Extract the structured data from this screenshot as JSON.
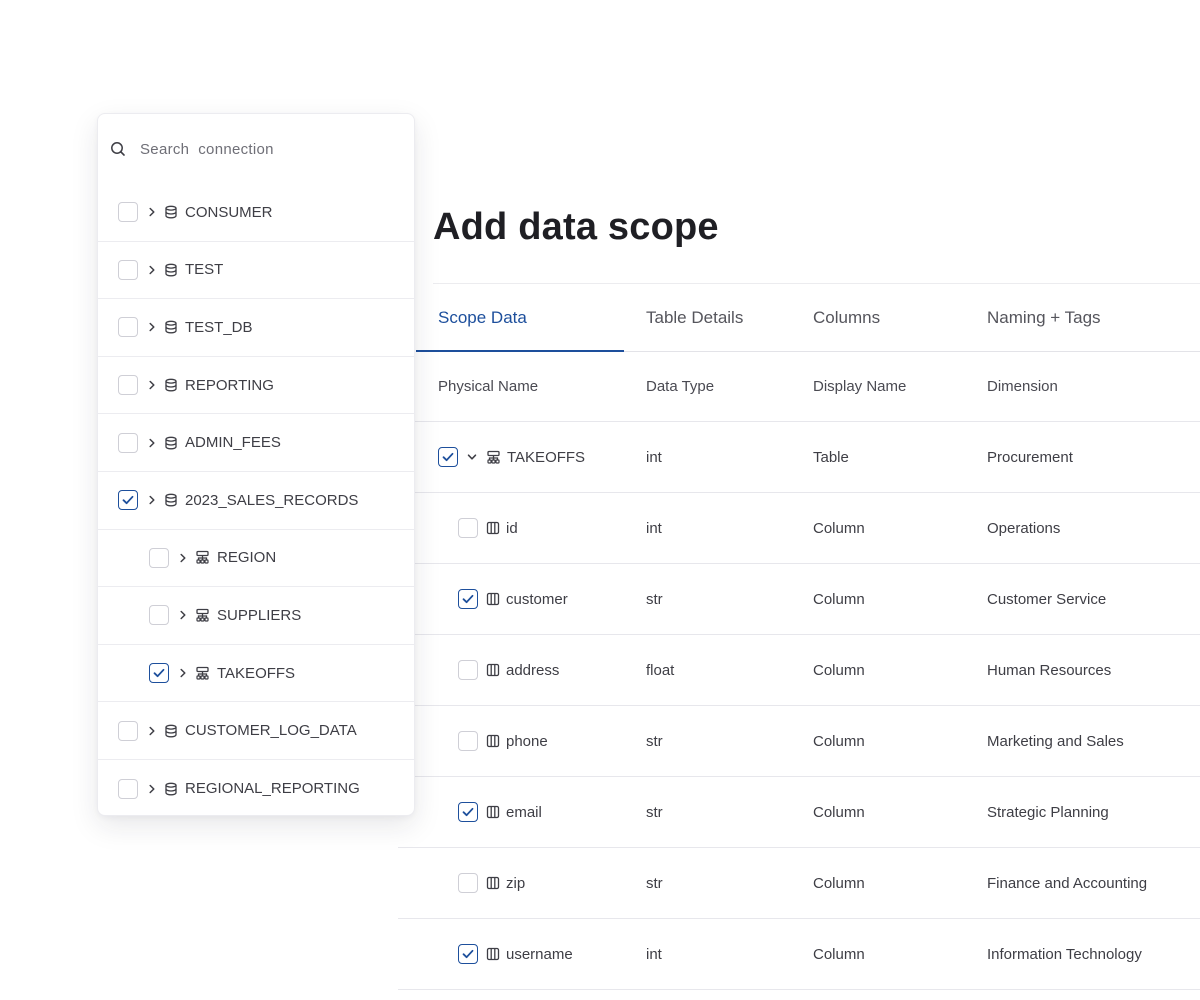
{
  "title": "Add data scope",
  "search": {
    "placeholder": "Search  connection"
  },
  "tabs": [
    {
      "label": "Scope Data",
      "active": true
    },
    {
      "label": "Table Details",
      "active": false
    },
    {
      "label": "Columns",
      "active": false
    },
    {
      "label": "Naming + Tags",
      "active": false
    }
  ],
  "columns": {
    "physical_name": "Physical Name",
    "data_type": "Data Type",
    "display_name": "Display Name",
    "dimension": "Dimension"
  },
  "rows": [
    {
      "name": "TAKEOFFS",
      "type": "int",
      "display": "Table",
      "dimension": "Procurement",
      "checked": true,
      "kind": "table"
    },
    {
      "name": "id",
      "type": "int",
      "display": "Column",
      "dimension": "Operations",
      "checked": false,
      "kind": "column"
    },
    {
      "name": "customer",
      "type": "str",
      "display": "Column",
      "dimension": "Customer Service",
      "checked": true,
      "kind": "column"
    },
    {
      "name": "address",
      "type": "float",
      "display": "Column",
      "dimension": "Human Resources",
      "checked": false,
      "kind": "column"
    },
    {
      "name": "phone",
      "type": "str",
      "display": "Column",
      "dimension": "Marketing and Sales",
      "checked": false,
      "kind": "column"
    },
    {
      "name": "email",
      "type": "str",
      "display": "Column",
      "dimension": "Strategic Planning",
      "checked": true,
      "kind": "column"
    },
    {
      "name": "zip",
      "type": "str",
      "display": "Column",
      "dimension": "Finance and Accounting",
      "checked": false,
      "kind": "column"
    },
    {
      "name": "username",
      "type": "int",
      "display": "Column",
      "dimension": "Information Technology",
      "checked": true,
      "kind": "column"
    }
  ],
  "tree": [
    {
      "label": "CONSUMER",
      "checked": false,
      "icon": "database-icon"
    },
    {
      "label": "TEST",
      "checked": false,
      "icon": "database-icon"
    },
    {
      "label": "TEST_DB",
      "checked": false,
      "icon": "database-icon"
    },
    {
      "label": "REPORTING",
      "checked": false,
      "icon": "database-icon"
    },
    {
      "label": "ADMIN_FEES",
      "checked": false,
      "icon": "database-icon"
    },
    {
      "label": "2023_SALES_RECORDS",
      "checked": true,
      "icon": "database-icon"
    },
    {
      "label": "REGION",
      "checked": false,
      "icon": "hierarchy-icon"
    },
    {
      "label": "SUPPLIERS",
      "checked": false,
      "icon": "hierarchy-icon"
    },
    {
      "label": "TAKEOFFS",
      "checked": true,
      "icon": "hierarchy-icon"
    },
    {
      "label": "CUSTOMER_LOG_DATA",
      "checked": false,
      "icon": "database-icon"
    },
    {
      "label": "REGIONAL_REPORTING",
      "checked": false,
      "icon": "database-icon"
    }
  ],
  "colors": {
    "accent": "#1d4f9c",
    "text": "#3e3e45",
    "heading": "#1f1f24",
    "border": "#e7e7ec"
  }
}
